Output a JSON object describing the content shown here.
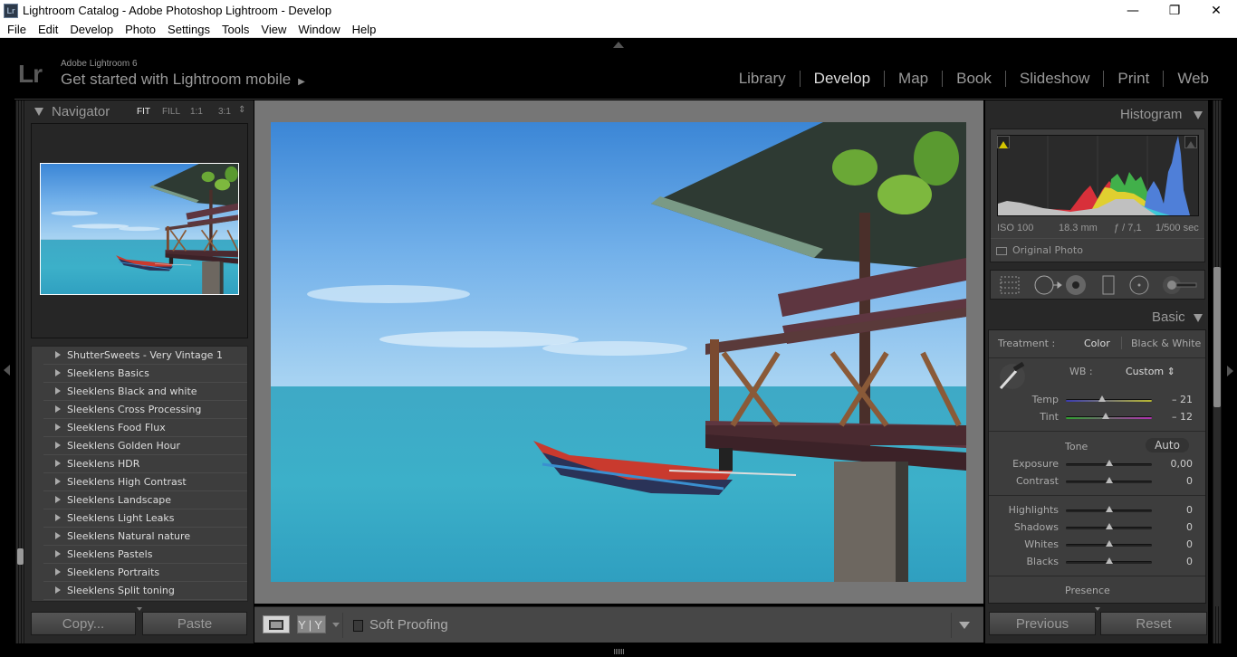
{
  "window": {
    "title": "Lightroom Catalog - Adobe Photoshop Lightroom - Develop",
    "app_icon": "Lr",
    "controls": {
      "minimize": "—",
      "restore": "❐",
      "close": "✕"
    }
  },
  "menubar": [
    "File",
    "Edit",
    "Develop",
    "Photo",
    "Settings",
    "Tools",
    "View",
    "Window",
    "Help"
  ],
  "identity": {
    "logo": "Lr",
    "product": "Adobe Lightroom 6",
    "tagline": "Get started with Lightroom mobile",
    "tagline_arrow": "▶"
  },
  "modules": [
    {
      "label": "Library",
      "active": false
    },
    {
      "label": "Develop",
      "active": true
    },
    {
      "label": "Map",
      "active": false
    },
    {
      "label": "Book",
      "active": false
    },
    {
      "label": "Slideshow",
      "active": false
    },
    {
      "label": "Print",
      "active": false
    },
    {
      "label": "Web",
      "active": false
    }
  ],
  "navigator": {
    "title": "Navigator",
    "zoom_options": [
      "FIT",
      "FILL",
      "1:1",
      "3:1"
    ],
    "zoom_selected": "FIT",
    "zoom_stepper": "⇕"
  },
  "presets": [
    "ShutterSweets - Very Vintage 1",
    "Sleeklens Basics",
    "Sleeklens Black and white",
    "Sleeklens Cross Processing",
    "Sleeklens Food Flux",
    "Sleeklens Golden Hour",
    "Sleeklens HDR",
    "Sleeklens High Contrast",
    "Sleeklens Landscape",
    "Sleeklens Light Leaks",
    "Sleeklens Natural nature",
    "Sleeklens Pastels",
    "Sleeklens Portraits",
    "Sleeklens Split toning"
  ],
  "left_buttons": {
    "copy": "Copy...",
    "paste": "Paste"
  },
  "toolbar": {
    "compare_label": "Y|Y",
    "soft_proofing_label": "Soft Proofing",
    "soft_proofing_checked": false
  },
  "histogram": {
    "title": "Histogram",
    "exif": {
      "iso": "ISO 100",
      "focal": "18.3 mm",
      "aperture": "ƒ / 7,1",
      "shutter": "1/500 sec"
    },
    "original_photo_label": "Original Photo",
    "original_photo_checked": false
  },
  "tools": [
    "crop-overlay",
    "spot-removal",
    "red-eye",
    "graduated-filter",
    "radial-filter",
    "adjustment-brush"
  ],
  "basic": {
    "title": "Basic",
    "treatment_label": "Treatment :",
    "treatment_options": [
      "Color",
      "Black & White"
    ],
    "treatment_selected": "Color",
    "wb_label": "WB :",
    "wb_value": "Custom",
    "wb_stepper": "⇕",
    "tone_label": "Tone",
    "auto_label": "Auto",
    "presence_label": "Presence",
    "sliders": [
      {
        "name": "temp",
        "label": "Temp",
        "value": "– 21",
        "position": 0.42
      },
      {
        "name": "tint",
        "label": "Tint",
        "value": "– 12",
        "position": 0.46
      },
      {
        "name": "exposure",
        "label": "Exposure",
        "value": "0,00",
        "position": 0.5
      },
      {
        "name": "contrast",
        "label": "Contrast",
        "value": "0",
        "position": 0.5
      },
      {
        "name": "highlights",
        "label": "Highlights",
        "value": "0",
        "position": 0.5
      },
      {
        "name": "shadows",
        "label": "Shadows",
        "value": "0",
        "position": 0.5
      },
      {
        "name": "whites",
        "label": "Whites",
        "value": "0",
        "position": 0.5
      },
      {
        "name": "blacks",
        "label": "Blacks",
        "value": "0",
        "position": 0.5
      }
    ]
  },
  "right_buttons": {
    "previous": "Previous",
    "reset": "Reset"
  },
  "colors": {
    "panel_bg": "#282828",
    "section_bg": "#3d3d3d",
    "canvas_bg": "#767676",
    "active_module": "#dddddd",
    "inactive_module": "#999999"
  }
}
